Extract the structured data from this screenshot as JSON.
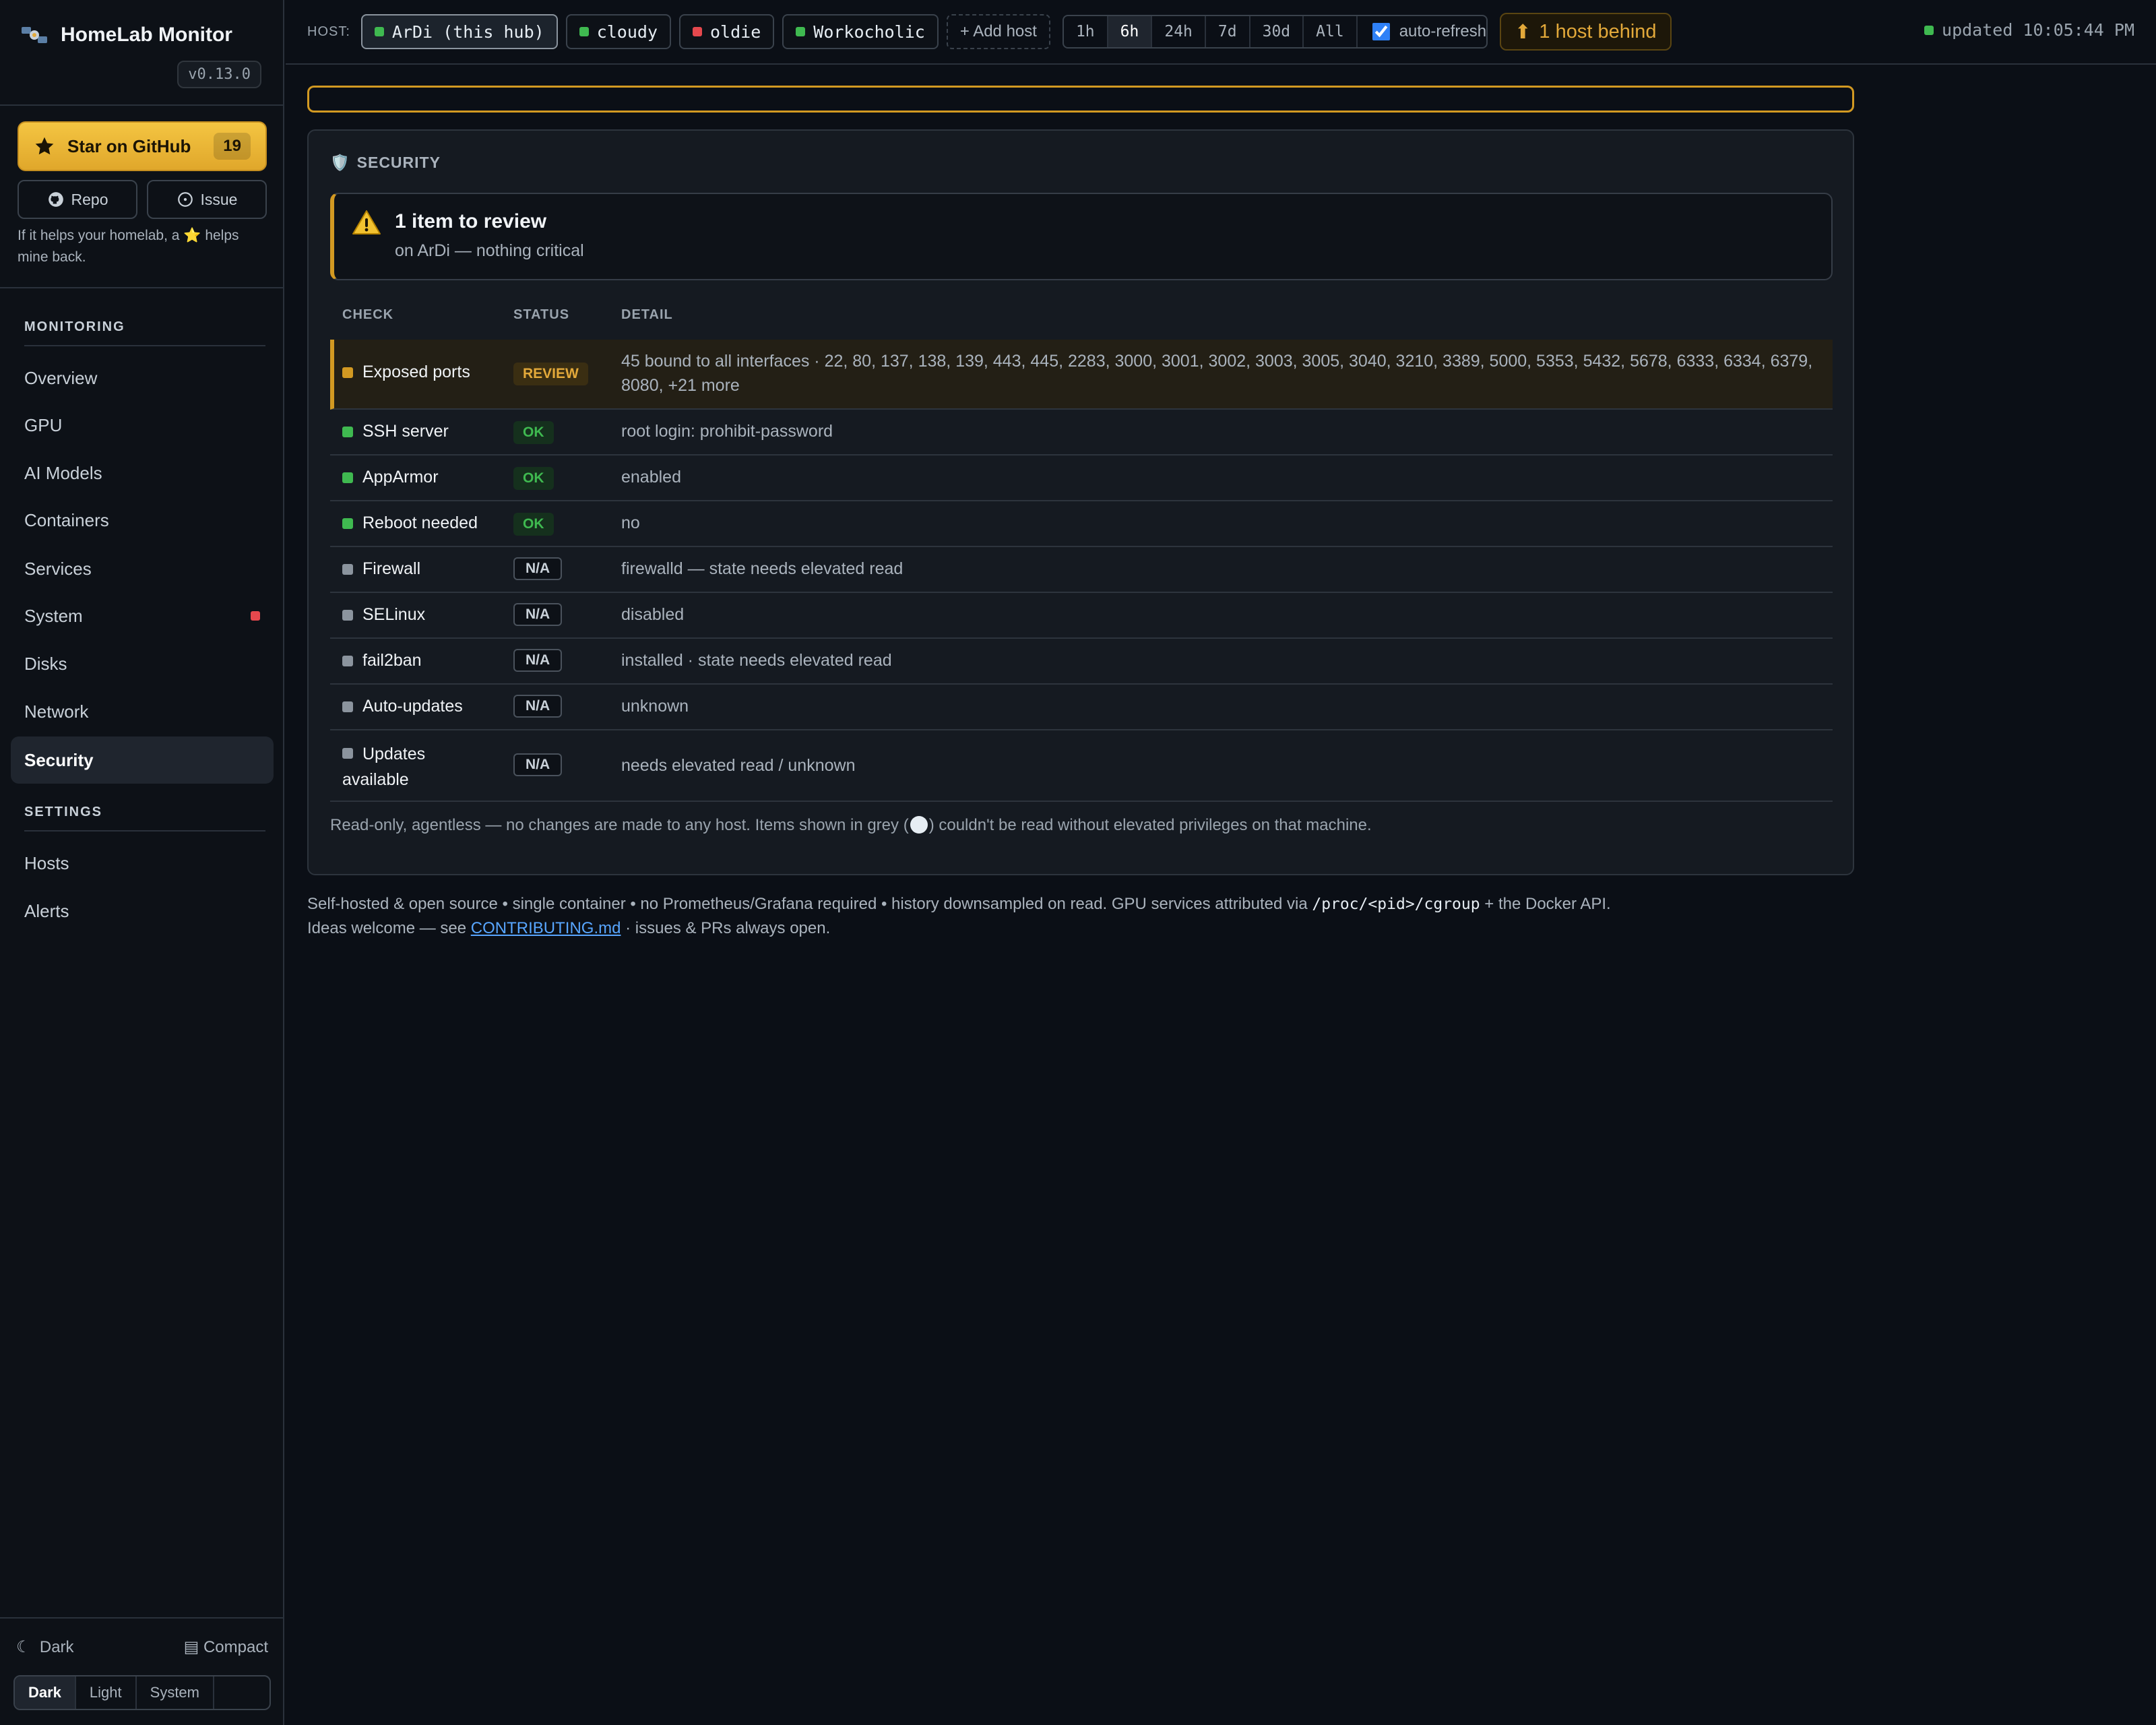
{
  "brand": {
    "name": "HomeLab Monitor",
    "version": "v0.13.0"
  },
  "sidebar": {
    "star_label": "Star on GitHub",
    "star_count": "19",
    "repo_label": "Repo",
    "issue_label": "Issue",
    "helper_text_1": "If it helps your homelab, a",
    "helper_star": "⭐",
    "helper_text_2": "helps mine back.",
    "monitoring_heading": "MONITORING",
    "items": [
      {
        "label": "Overview"
      },
      {
        "label": "GPU"
      },
      {
        "label": "AI Models"
      },
      {
        "label": "Containers"
      },
      {
        "label": "Services"
      },
      {
        "label": "System"
      },
      {
        "label": "Disks"
      },
      {
        "label": "Network"
      },
      {
        "label": "Security"
      }
    ],
    "settings_heading": "SETTINGS",
    "settings_items": [
      {
        "label": "Hosts"
      },
      {
        "label": "Alerts"
      }
    ],
    "theme_current": "Dark",
    "compact_label": "Compact",
    "theme_options": [
      "Dark",
      "Light",
      "System"
    ]
  },
  "topbar": {
    "host_label": "HOST:",
    "hosts": [
      {
        "name": "ArDi (this hub)",
        "status": "up"
      },
      {
        "name": "cloudy",
        "status": "up"
      },
      {
        "name": "oldie",
        "status": "down"
      },
      {
        "name": "Workocholic",
        "status": "up"
      }
    ],
    "add_host": "+ Add host",
    "ranges": [
      "1h",
      "6h",
      "24h",
      "7d",
      "30d",
      "All"
    ],
    "selected_range": "6h",
    "auto_refresh_label": "auto-refresh",
    "behind_icon": "⬆",
    "behind_label": "1 host behind",
    "updated": "updated 10:05:44 PM"
  },
  "security": {
    "title": "SECURITY",
    "title_icon": "🛡️",
    "summary_title": "1 item to review",
    "summary_sub": "on ArDi — nothing critical",
    "columns": [
      "CHECK",
      "STATUS",
      "DETAIL"
    ],
    "rows": [
      {
        "check": "Exposed ports",
        "status": "REVIEW",
        "detail": "45 bound to all interfaces · 22, 80, 137, 138, 139, 443, 445, 2283, 3000, 3001, 3002, 3003, 3005, 3040, 3210, 3389, 5000, 5353, 5432, 5678, 6333, 6334, 6379, 8080, +21 more"
      },
      {
        "check": "SSH server",
        "status": "OK",
        "detail": "root login: prohibit-password"
      },
      {
        "check": "AppArmor",
        "status": "OK",
        "detail": "enabled"
      },
      {
        "check": "Reboot needed",
        "status": "OK",
        "detail": "no"
      },
      {
        "check": "Firewall",
        "status": "N/A",
        "detail": "firewalld — state needs elevated read"
      },
      {
        "check": "SELinux",
        "status": "N/A",
        "detail": "disabled"
      },
      {
        "check": "fail2ban",
        "status": "N/A",
        "detail": "installed · state needs elevated read"
      },
      {
        "check": "Auto-updates",
        "status": "N/A",
        "detail": "unknown"
      },
      {
        "check": "Updates available",
        "status": "N/A",
        "detail": "needs elevated read / unknown"
      }
    ],
    "note_before": "Read-only, agentless — no changes are made to any host. Items shown in grey (",
    "note_after": ") couldn't be read without elevated privileges on that machine."
  },
  "footer": {
    "line1_text": "Self-hosted & open source • single container • no Prometheus/Grafana required • history downsampled on read. GPU services attributed via",
    "line1_code": "/proc/<pid>/cgroup",
    "line1_end": "+ the Docker API.",
    "line2_start": "Ideas welcome — see",
    "line2_link": "CONTRIBUTING.md",
    "line2_end": "· issues & PRs always open."
  },
  "colors": {
    "accent_amber": "#d29922",
    "ok_green": "#3fb950",
    "down_red": "#e5484d",
    "na_grey": "#8b949e",
    "link_blue": "#58a6ff"
  }
}
